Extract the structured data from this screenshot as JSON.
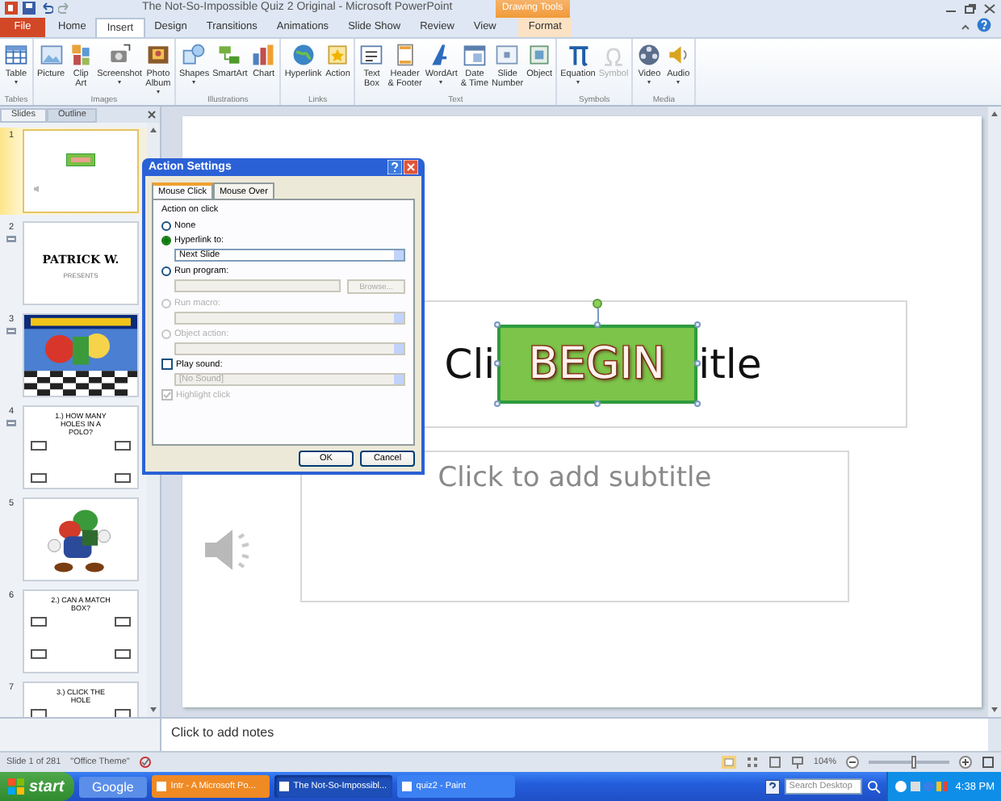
{
  "window": {
    "title": "The Not-So-Impossible Quiz 2 Original - Microsoft PowerPoint",
    "contextual_group": "Drawing Tools"
  },
  "tabs": [
    {
      "label": "File",
      "kind": "file",
      "selected": false
    },
    {
      "label": "Home",
      "kind": "tab",
      "selected": false
    },
    {
      "label": "Insert",
      "kind": "tab",
      "selected": true
    },
    {
      "label": "Design",
      "kind": "tab",
      "selected": false
    },
    {
      "label": "Transitions",
      "kind": "tab",
      "selected": false
    },
    {
      "label": "Animations",
      "kind": "tab",
      "selected": false
    },
    {
      "label": "Slide Show",
      "kind": "tab",
      "selected": false
    },
    {
      "label": "Review",
      "kind": "tab",
      "selected": false
    },
    {
      "label": "View",
      "kind": "tab",
      "selected": false
    },
    {
      "label": "Format",
      "kind": "contextual",
      "selected": false
    }
  ],
  "ribbon_groups": [
    {
      "label": "Tables",
      "buttons": [
        {
          "lines": [
            "Table"
          ],
          "dropdown": true,
          "disabled": false
        }
      ]
    },
    {
      "label": "Images",
      "buttons": [
        {
          "lines": [
            "Picture"
          ],
          "dropdown": false,
          "disabled": false
        },
        {
          "lines": [
            "Clip",
            "Art"
          ],
          "dropdown": false,
          "disabled": false
        },
        {
          "lines": [
            "Screenshot"
          ],
          "dropdown": true,
          "disabled": false
        },
        {
          "lines": [
            "Photo",
            "Album"
          ],
          "dropdown": true,
          "disabled": false
        }
      ]
    },
    {
      "label": "Illustrations",
      "buttons": [
        {
          "lines": [
            "Shapes"
          ],
          "dropdown": true,
          "disabled": false
        },
        {
          "lines": [
            "SmartArt"
          ],
          "dropdown": false,
          "disabled": false
        },
        {
          "lines": [
            "Chart"
          ],
          "dropdown": false,
          "disabled": false
        }
      ]
    },
    {
      "label": "Links",
      "buttons": [
        {
          "lines": [
            "Hyperlink"
          ],
          "dropdown": false,
          "disabled": false
        },
        {
          "lines": [
            "Action"
          ],
          "dropdown": false,
          "disabled": false
        }
      ]
    },
    {
      "label": "Text",
      "buttons": [
        {
          "lines": [
            "Text",
            "Box"
          ],
          "dropdown": false,
          "disabled": false
        },
        {
          "lines": [
            "Header",
            "& Footer"
          ],
          "dropdown": false,
          "disabled": false
        },
        {
          "lines": [
            "WordArt"
          ],
          "dropdown": true,
          "disabled": false
        },
        {
          "lines": [
            "Date",
            "& Time"
          ],
          "dropdown": false,
          "disabled": false
        },
        {
          "lines": [
            "Slide",
            "Number"
          ],
          "dropdown": false,
          "disabled": false
        },
        {
          "lines": [
            "Object"
          ],
          "dropdown": false,
          "disabled": false
        }
      ]
    },
    {
      "label": "Symbols",
      "buttons": [
        {
          "lines": [
            "Equation"
          ],
          "dropdown": true,
          "disabled": false
        },
        {
          "lines": [
            "Symbol"
          ],
          "dropdown": false,
          "disabled": true
        }
      ]
    },
    {
      "label": "Media",
      "buttons": [
        {
          "lines": [
            "Video"
          ],
          "dropdown": true,
          "disabled": false
        },
        {
          "lines": [
            "Audio"
          ],
          "dropdown": true,
          "disabled": false
        }
      ]
    }
  ],
  "panel_tabs": [
    {
      "label": "Slides",
      "selected": true
    },
    {
      "label": "Outline",
      "selected": false
    }
  ],
  "slides": [
    {
      "number": "1",
      "kind": "begin",
      "selected": true,
      "animated": false
    },
    {
      "number": "2",
      "kind": "title",
      "selected": false,
      "animated": true,
      "lines": [
        "PATRICK W.",
        "PRESENTS"
      ]
    },
    {
      "number": "3",
      "kind": "picture",
      "selected": false,
      "animated": true
    },
    {
      "number": "4",
      "kind": "question",
      "selected": false,
      "animated": true,
      "lines": [
        "1.) HOW MANY HOLES IN A POLO?"
      ]
    },
    {
      "number": "5",
      "kind": "picture",
      "selected": false,
      "animated": false
    },
    {
      "number": "6",
      "kind": "question",
      "selected": false,
      "animated": false,
      "lines": [
        "2.) CAN A MATCH BOX?"
      ]
    },
    {
      "number": "7",
      "kind": "question",
      "selected": false,
      "animated": false,
      "lines": [
        "3.) CLICK THE HOLE"
      ]
    }
  ],
  "slide": {
    "title_before": "Cli",
    "shape_text": "BEGIN",
    "title_after": "itle",
    "subtitle": "Click to add subtitle"
  },
  "dialog": {
    "title": "Action Settings",
    "tabs": [
      {
        "label": "Mouse Click",
        "selected": true
      },
      {
        "label": "Mouse Over",
        "selected": false
      }
    ],
    "section": "Action on click",
    "options": [
      {
        "kind": "radio",
        "label": "None",
        "selected": false,
        "disabled": false
      },
      {
        "kind": "radio",
        "label": "Hyperlink to:",
        "selected": true,
        "disabled": false
      },
      {
        "kind": "select",
        "value": "Next Slide",
        "disabled": false
      },
      {
        "kind": "radio",
        "label": "Run program:",
        "selected": false,
        "disabled": false
      },
      {
        "kind": "browse",
        "button": "Browse...",
        "disabled": true
      },
      {
        "kind": "radio",
        "label": "Run macro:",
        "selected": false,
        "disabled": true
      },
      {
        "kind": "select",
        "disabled": true
      },
      {
        "kind": "radio",
        "label": "Object action:",
        "selected": false,
        "disabled": true
      },
      {
        "kind": "select",
        "disabled": true
      },
      {
        "kind": "checkbox",
        "label": "Play sound:",
        "checked": false,
        "disabled": false
      },
      {
        "kind": "select",
        "value": "[No Sound]",
        "disabled": true
      },
      {
        "kind": "checkbox",
        "label": "Highlight click",
        "checked": true,
        "disabled": true
      }
    ],
    "buttons": [
      "OK",
      "Cancel"
    ]
  },
  "notes": {
    "placeholder": "Click to add notes"
  },
  "status_bar": {
    "slide": "Slide 1 of 281",
    "theme": "\"Office Theme\"",
    "zoom": "104%",
    "zoom_slider": {
      "level": 0.55
    }
  },
  "taskbar": {
    "start": "start",
    "toolbar": "Google",
    "tasks": [
      {
        "label": "Intr - A Microsoft Po...",
        "selected": false,
        "flashing": true
      },
      {
        "label": "The Not-So-Impossibl...",
        "selected": true,
        "flashing": false
      },
      {
        "label": "quiz2 - Paint",
        "selected": false,
        "flashing": false
      }
    ],
    "search_placeholder": "Search Desktop",
    "time": "4:38 PM"
  }
}
